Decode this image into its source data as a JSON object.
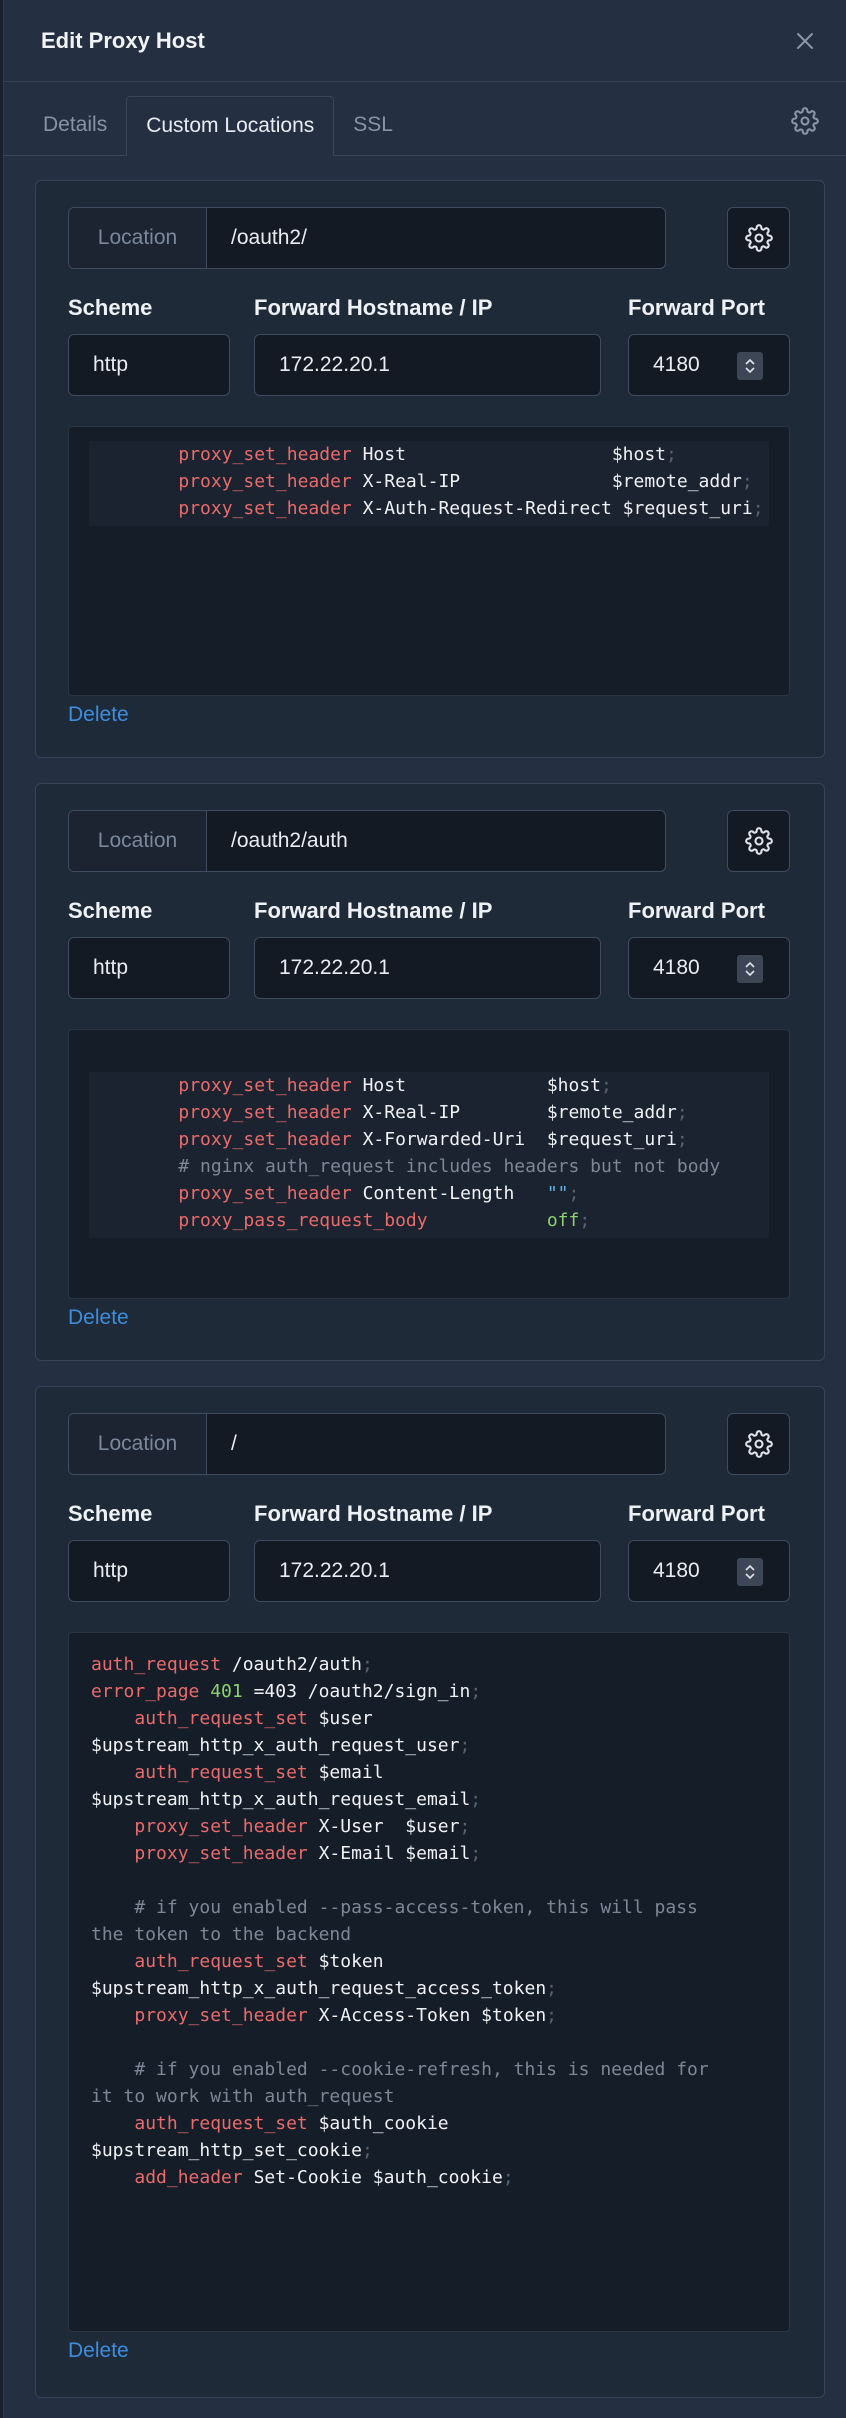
{
  "header": {
    "title": "Edit Proxy Host"
  },
  "tabs": [
    "Details",
    "Custom Locations",
    "SSL"
  ],
  "common": {
    "location_label": "Location",
    "scheme_label": "Scheme",
    "host_label": "Forward Hostname / IP",
    "port_label": "Forward Port",
    "delete_label": "Delete"
  },
  "locations": [
    {
      "path": "/oauth2/",
      "scheme": "http",
      "host": "172.22.20.1",
      "port": "4180"
    },
    {
      "path": "/oauth2/auth",
      "scheme": "http",
      "host": "172.22.20.1",
      "port": "4180"
    },
    {
      "path": "/",
      "scheme": "http",
      "host": "172.22.20.1",
      "port": "4180"
    }
  ],
  "code_blocks": [
    [
      [
        [
          "    ",
          ""
        ],
        [
          "proxy_set_header",
          "kw"
        ],
        [
          " Host                   $host",
          ""
        ],
        [
          ";",
          "pn"
        ]
      ],
      [
        [
          "    ",
          ""
        ],
        [
          "proxy_set_header",
          "kw"
        ],
        [
          " X-Real-IP              $remote_addr",
          ""
        ],
        [
          ";",
          "pn"
        ]
      ],
      [
        [
          "    ",
          ""
        ],
        [
          "proxy_set_header",
          "kw"
        ],
        [
          " X-Auth-Request-Redirect $request_uri",
          ""
        ],
        [
          ";",
          "pn"
        ]
      ]
    ],
    [
      [
        [
          "    ",
          ""
        ],
        [
          "proxy_set_header",
          "kw"
        ],
        [
          " Host             $host",
          ""
        ],
        [
          ";",
          "pn"
        ]
      ],
      [
        [
          "    ",
          ""
        ],
        [
          "proxy_set_header",
          "kw"
        ],
        [
          " X-Real-IP        $remote_addr",
          ""
        ],
        [
          ";",
          "pn"
        ]
      ],
      [
        [
          "    ",
          ""
        ],
        [
          "proxy_set_header",
          "kw"
        ],
        [
          " X-Forwarded-Uri  $request_uri",
          ""
        ],
        [
          ";",
          "pn"
        ]
      ],
      [
        [
          "    ",
          ""
        ],
        [
          "# nginx auth_request includes headers but not body",
          "cm"
        ]
      ],
      [
        [
          "    ",
          ""
        ],
        [
          "proxy_set_header",
          "kw"
        ],
        [
          " Content-Length   ",
          ""
        ],
        [
          "\"\"",
          "st"
        ],
        [
          ";",
          "pn"
        ]
      ],
      [
        [
          "    ",
          ""
        ],
        [
          "proxy_pass_request_body",
          "kw"
        ],
        [
          "           ",
          ""
        ],
        [
          "off",
          "nm"
        ],
        [
          ";",
          "pn"
        ]
      ]
    ],
    [
      [
        [
          "auth_request",
          "kw"
        ],
        [
          " /oauth2/auth",
          ""
        ],
        [
          ";",
          "pn"
        ]
      ],
      [
        [
          "error_page",
          "kw"
        ],
        [
          " ",
          ""
        ],
        [
          "401",
          "nm"
        ],
        [
          " =403 /oauth2/sign_in",
          ""
        ],
        [
          ";",
          "pn"
        ]
      ],
      [
        [
          "    ",
          ""
        ],
        [
          "auth_request_set",
          "kw"
        ],
        [
          " $user",
          ""
        ]
      ],
      [
        [
          "$upstream_http_x_auth_request_user",
          ""
        ],
        [
          ";",
          "pn"
        ]
      ],
      [
        [
          "    ",
          ""
        ],
        [
          "auth_request_set",
          "kw"
        ],
        [
          " $email",
          ""
        ]
      ],
      [
        [
          "$upstream_http_x_auth_request_email",
          ""
        ],
        [
          ";",
          "pn"
        ]
      ],
      [
        [
          "    ",
          ""
        ],
        [
          "proxy_set_header",
          "kw"
        ],
        [
          " X-User  $user",
          ""
        ],
        [
          ";",
          "pn"
        ]
      ],
      [
        [
          "    ",
          ""
        ],
        [
          "proxy_set_header",
          "kw"
        ],
        [
          " X-Email $email",
          ""
        ],
        [
          ";",
          "pn"
        ]
      ],
      [
        [
          "",
          ""
        ]
      ],
      [
        [
          "    ",
          ""
        ],
        [
          "# if you enabled --pass-access-token, this will pass",
          "cm"
        ]
      ],
      [
        [
          "the token to the backend",
          "cm"
        ]
      ],
      [
        [
          "    ",
          ""
        ],
        [
          "auth_request_set",
          "kw"
        ],
        [
          " $token",
          ""
        ]
      ],
      [
        [
          "$upstream_http_x_auth_request_access_token",
          ""
        ],
        [
          ";",
          "pn"
        ]
      ],
      [
        [
          "    ",
          ""
        ],
        [
          "proxy_set_header",
          "kw"
        ],
        [
          " X-Access-Token $token",
          ""
        ],
        [
          ";",
          "pn"
        ]
      ],
      [
        [
          "",
          ""
        ]
      ],
      [
        [
          "    ",
          ""
        ],
        [
          "# if you enabled --cookie-refresh, this is needed for",
          "cm"
        ]
      ],
      [
        [
          "it to work with auth_request",
          "cm"
        ]
      ],
      [
        [
          "    ",
          ""
        ],
        [
          "auth_request_set",
          "kw"
        ],
        [
          " $auth_cookie",
          ""
        ]
      ],
      [
        [
          "$upstream_http_set_cookie",
          ""
        ],
        [
          ";",
          "pn"
        ]
      ],
      [
        [
          "    ",
          ""
        ],
        [
          "add_header",
          "kw"
        ],
        [
          " Set-Cookie $auth_cookie",
          ""
        ],
        [
          ";",
          "pn"
        ]
      ]
    ]
  ]
}
